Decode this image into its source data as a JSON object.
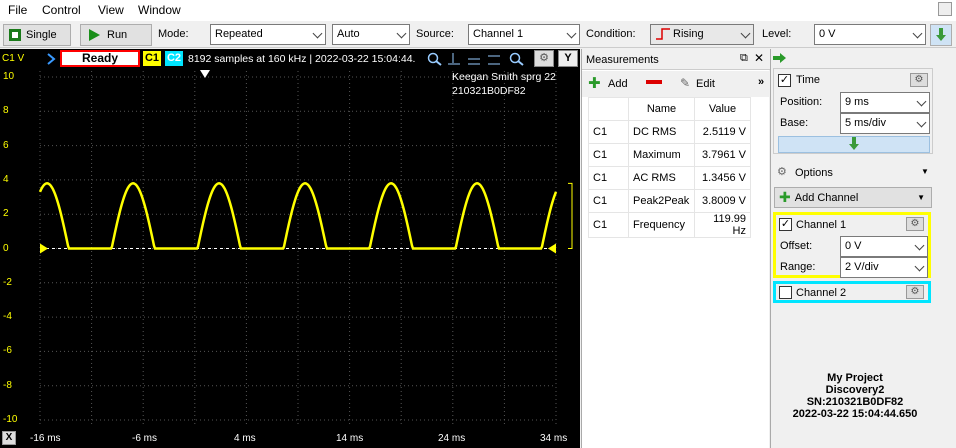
{
  "menu": [
    "File",
    "Control",
    "View",
    "Window"
  ],
  "toolbar": {
    "single_label": "Single",
    "run_label": "Run",
    "mode_label": "Mode:",
    "mode_value": "Repeated",
    "trigger_value": "Auto",
    "source_label": "Source:",
    "source_value": "Channel 1",
    "condition_label": "Condition:",
    "condition_value": "Rising",
    "level_label": "Level:",
    "level_value": "0 V"
  },
  "scope": {
    "ch_label": "C1 V",
    "status": "Ready",
    "c1": "C1",
    "c2": "C2",
    "info": "8192 samples at 160 kHz | 2022-03-22 15:04:44.",
    "y_label": "Y",
    "note_line1": "Keegan Smith sprg 22",
    "note_line2": "210321B0DF82",
    "x_corner": "X",
    "y_ticks": [
      "10",
      "8",
      "6",
      "4",
      "2",
      "0",
      "-2",
      "-4",
      "-6",
      "-8",
      "-10"
    ],
    "x_ticks": [
      "-16 ms",
      "-6 ms",
      "4 ms",
      "14 ms",
      "24 ms",
      "34 ms"
    ],
    "colors": {
      "ch1": "#ffff00",
      "ch2": "#00e5ff",
      "status_border": "#ff0000"
    }
  },
  "chart_data": {
    "type": "line",
    "xlabel": "",
    "ylabel": "C1 V",
    "xlim": [
      -16,
      34
    ],
    "ylim": [
      -10,
      10
    ],
    "grid": true,
    "series": [
      {
        "name": "C1",
        "description": "rectified sine, ~120 Hz, peak ~3.8 V, floor ~0 V",
        "peak": 3.8,
        "frequency_hz": 120,
        "x_unit": "ms",
        "y_unit": "V"
      }
    ]
  },
  "measurements": {
    "title": "Measurements",
    "add_label": "Add",
    "edit_label": "Edit",
    "headers": [
      "Name",
      "Value"
    ],
    "rows": [
      {
        "ch": "C1",
        "name": "DC RMS",
        "value": "2.5119 V"
      },
      {
        "ch": "C1",
        "name": "Maximum",
        "value": "3.7961 V"
      },
      {
        "ch": "C1",
        "name": "AC RMS",
        "value": "1.3456 V"
      },
      {
        "ch": "C1",
        "name": "Peak2Peak",
        "value": "3.8009 V"
      },
      {
        "ch": "C1",
        "name": "Frequency",
        "value": "119.99 Hz"
      }
    ]
  },
  "side": {
    "time_label": "Time",
    "position_label": "Position:",
    "position_value": "9 ms",
    "base_label": "Base:",
    "base_value": "5 ms/div",
    "options_label": "Options",
    "add_channel_label": "Add Channel",
    "ch1_label": "Channel 1",
    "offset_label": "Offset:",
    "offset_value": "0 V",
    "range_label": "Range:",
    "range_value": "2 V/div",
    "ch2_label": "Channel 2",
    "project_line1": "My Project",
    "project_line2": "Discovery2",
    "project_line3": "SN:210321B0DF82",
    "project_line4": "2022-03-22 15:04:44.650"
  }
}
